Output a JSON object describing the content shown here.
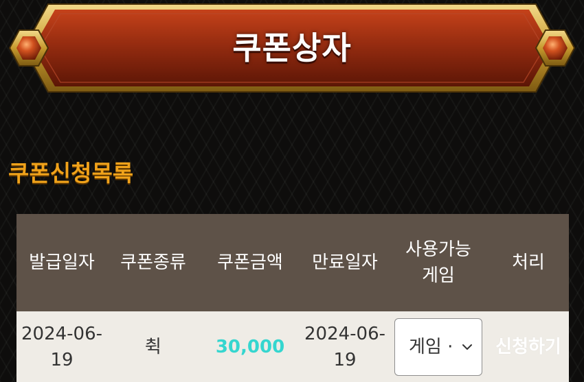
{
  "banner": {
    "title": "쿠폰상자"
  },
  "section": {
    "title": "쿠폰신청목록"
  },
  "table": {
    "headers": {
      "issue_date": "발급일자",
      "coupon_type": "쿠폰종류",
      "coupon_amount": "쿠폰금액",
      "expire_date": "만료일자",
      "available_game_line1": "사용가능",
      "available_game_line2": "게임",
      "action": "처리"
    },
    "rows": [
      {
        "issue_date_line1": "2024-06-",
        "issue_date_line2": "19",
        "coupon_type": "췩",
        "coupon_amount": "30,000",
        "expire_date_line1": "2024-06-",
        "expire_date_line2": "19",
        "game_select_value": "게임 ·",
        "action_label": "신청하기"
      }
    ]
  },
  "colors": {
    "background": "#0e0d0c",
    "banner_fill": "#8f2a10",
    "banner_frame": "#d8b34a",
    "section_title": "#f0a21a",
    "header_bg": "#5e5248",
    "row_bg": "#efece6",
    "amount": "#35d6cf"
  },
  "icons": {
    "banner_gems": "hexagon-gem-icon",
    "select_arrow": "chevron-down-icon"
  }
}
